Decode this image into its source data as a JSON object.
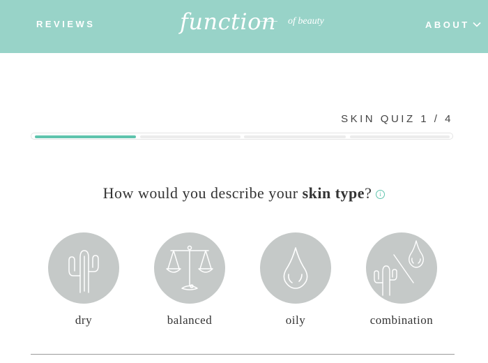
{
  "header": {
    "nav_left": "REVIEWS",
    "nav_right": "ABOUT",
    "logo_main": "function",
    "logo_sub": "of beauty",
    "background": "#98d3c8"
  },
  "quiz": {
    "label": "SKIN QUIZ 1 / 4",
    "current_step": 1,
    "total_steps": 4,
    "accent": "#5fc4ad"
  },
  "question": {
    "prefix": "How would you describe your ",
    "emphasis": "skin type",
    "suffix": "?",
    "info_icon": "i"
  },
  "options": [
    {
      "label": "dry",
      "icon": "cactus-icon"
    },
    {
      "label": "balanced",
      "icon": "scale-icon"
    },
    {
      "label": "oily",
      "icon": "droplet-icon"
    },
    {
      "label": "combination",
      "icon": "cactus-droplet-icon"
    }
  ]
}
